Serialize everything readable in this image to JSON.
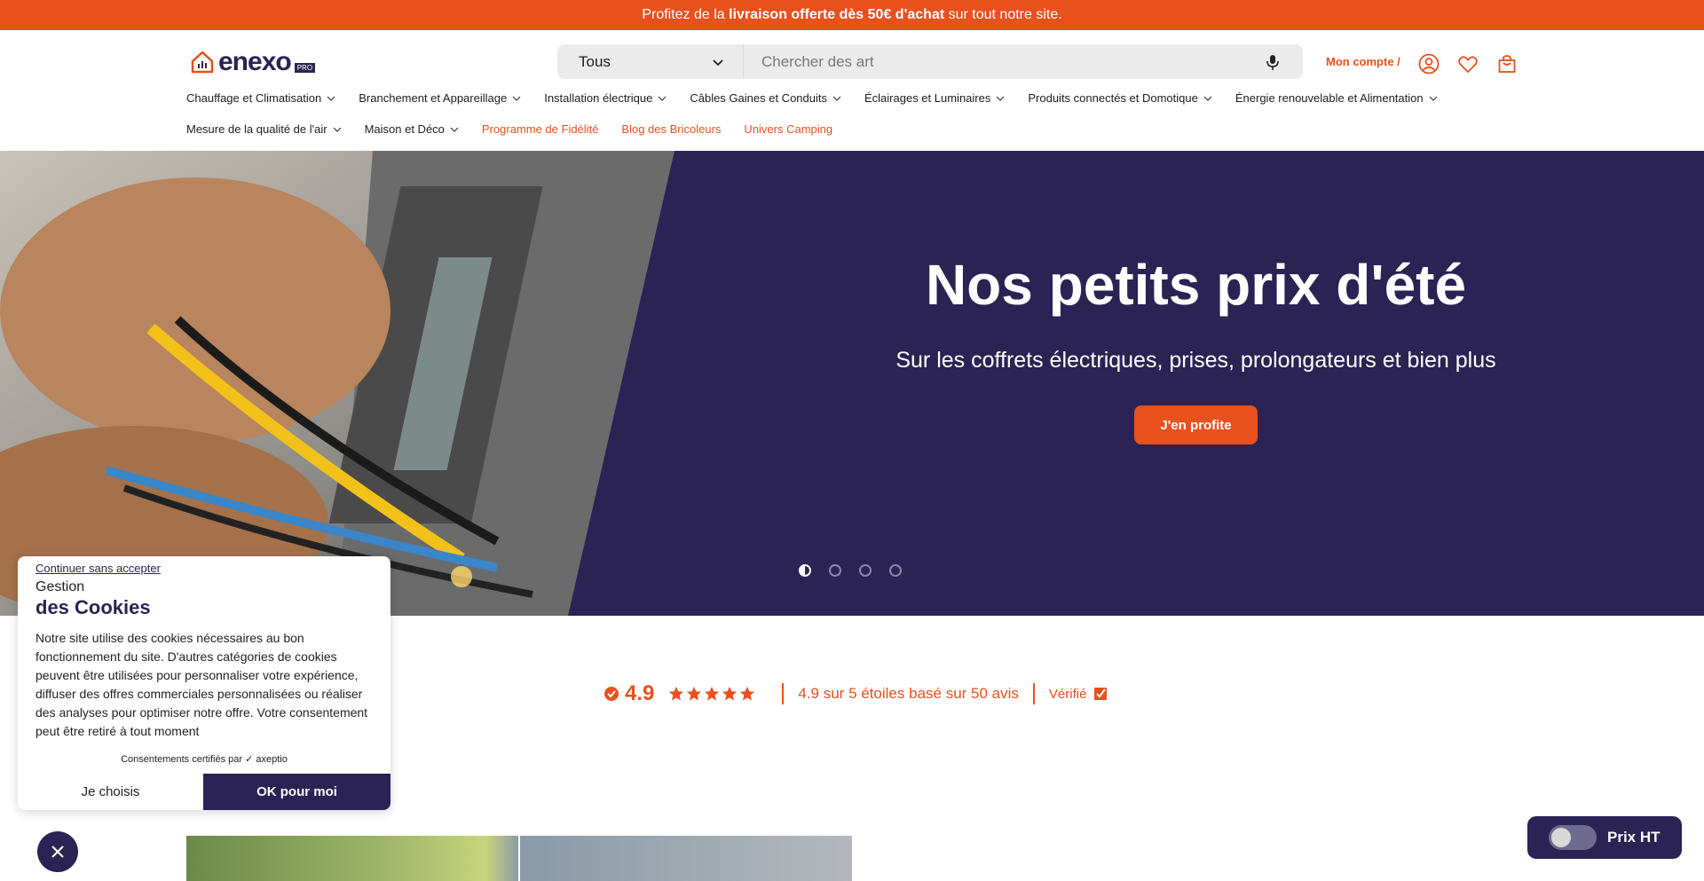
{
  "topbar": {
    "prefix": "Profitez de la ",
    "bold": "livraison offerte dès 50€ d'achat",
    "suffix": " sur tout notre site."
  },
  "logo": {
    "word": "enexo",
    "pro": "PRO"
  },
  "search": {
    "category": "Tous",
    "placeholder": "Chercher des art"
  },
  "account": {
    "label": "Mon compte /"
  },
  "nav": {
    "row1": [
      "Chauffage et Climatisation",
      "Branchement et Appareillage",
      "Installation électrique",
      "Câbles Gaines et Conduits",
      "Éclairages et Luminaires",
      "Produits connectés et Domotique",
      "Énergie renouvelable et Alimentation"
    ],
    "row2": [
      "Mesure de la qualité de l'air",
      "Maison et Déco"
    ],
    "row2_links": [
      "Programme de Fidélité",
      "Blog des Bricoleurs",
      "Univers Camping"
    ]
  },
  "hero": {
    "title": "Nos petits prix d'été",
    "subtitle": "Sur les coffrets électriques, prises, prolongateurs et bien plus",
    "cta": "J'en profite",
    "active_slide": 1,
    "slide_count": 4
  },
  "rating": {
    "score": "4.9",
    "summary": "4.9 sur 5 étoiles basé sur 50 avis",
    "verified": "Vérifié"
  },
  "cookie": {
    "skip": "Continuer sans accepter",
    "heading_line1": "Gestion",
    "heading_line2": "des Cookies",
    "text": "Notre site utilise des cookies nécessaires au bon fonctionnement du site. D'autres catégories de cookies peuvent être utilisées pour personnaliser votre expérience, diffuser des offres commerciales personnalisées ou réaliser des analyses pour optimiser notre offre. Votre consentement peut être retiré à tout moment",
    "certified": "Consentements certifiés par ✓ axeptio",
    "choose": "Je choisis",
    "ok": "OK pour moi"
  },
  "prix": {
    "label": "Prix HT"
  },
  "colors": {
    "accent": "#e8501e",
    "brand": "#2a2354"
  }
}
